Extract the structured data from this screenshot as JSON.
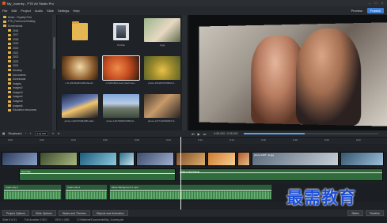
{
  "window": {
    "title": "My_Journey - PTE AV Studio Pro"
  },
  "menu": [
    "File",
    "Edit",
    "Project",
    "Audio",
    "Slide",
    "Settings",
    "Help"
  ],
  "header_buttons": {
    "preview": "Preview",
    "publish": "Publish"
  },
  "folder_tree": {
    "items": [
      "Music - Royalty Free",
      "PTE_FanCover/Holiday",
      "Screenshots",
      "2016",
      "2017",
      "2018",
      "2019",
      "2020",
      "2021",
      "2022",
      "2023",
      "2024",
      "Desktop",
      "Documents",
      "Downloads",
      "Images",
      "Images2",
      "Images3",
      "Images4",
      "Images5",
      "Images6",
      "Education resources"
    ]
  },
  "files": [
    {
      "name": "",
      "kind": "folder"
    },
    {
      "name": "Portrait",
      "kind": "folder"
    },
    {
      "name": "1.jpg",
      "kind": "photo"
    },
    {
      "name": "c-1L2f4c9fa8f-0d6b4dee4f...",
      "kind": "photo"
    },
    {
      "name": "c-0d20d3fd-1e2c-0ae6-4ea...",
      "kind": "photo"
    },
    {
      "name": "photo-1522020750094-1...",
      "kind": "photo"
    },
    {
      "name": "photo-1420379084986-da9...",
      "kind": "photo"
    },
    {
      "name": "photo-1467908497088-b6...",
      "kind": "photo"
    },
    {
      "name": "photo-1477146060897-f1...",
      "kind": "photo"
    }
  ],
  "toolbar": {
    "storyboard": "Storyboard",
    "zoom_value": "0:01.507"
  },
  "playback": {
    "time": "0:05.000 / 0:35.000"
  },
  "ruler_ticks": [
    "0:00",
    "0:02",
    "0:04",
    "0:06",
    "0:08",
    "0:10",
    "0:12",
    "0:14",
    "0:16",
    "0:18",
    "0:20",
    "0:22"
  ],
  "video_clips": [
    {
      "label": ""
    },
    {
      "label": ""
    },
    {
      "label": ""
    },
    {
      "label": ""
    },
    {
      "label": ""
    },
    {
      "label": ""
    },
    {
      "label": ""
    },
    {
      "label": ""
    },
    {
      "label": "photo-1487...fe.jpg"
    },
    {
      "label": ""
    }
  ],
  "text_clips": [
    "Text Clip",
    "Title in the Frame",
    "Title of the Frame clip"
  ],
  "audio_clips": [
    "Audio Clip 1",
    "Audio Clip 2",
    "Music Background 1.mp3"
  ],
  "bottom_buttons": [
    "Project Options",
    "Slide Options",
    "Styles and Themes",
    "Objects and Animation"
  ],
  "bottom_right_buttons": [
    "Slides",
    "Timeline"
  ],
  "status": {
    "slide": "Slide 8 of 11",
    "full_duration": "Full duration 0:35.0",
    "resolution": "1920 x 1080",
    "path": "D:\\Wladimir\\Documents\\My_Journey.pte"
  },
  "watermark": "最需教育",
  "colors": {
    "accent": "#3d7fd6",
    "audio": "#2c5c3a",
    "playhead": "#e8e8e8"
  }
}
